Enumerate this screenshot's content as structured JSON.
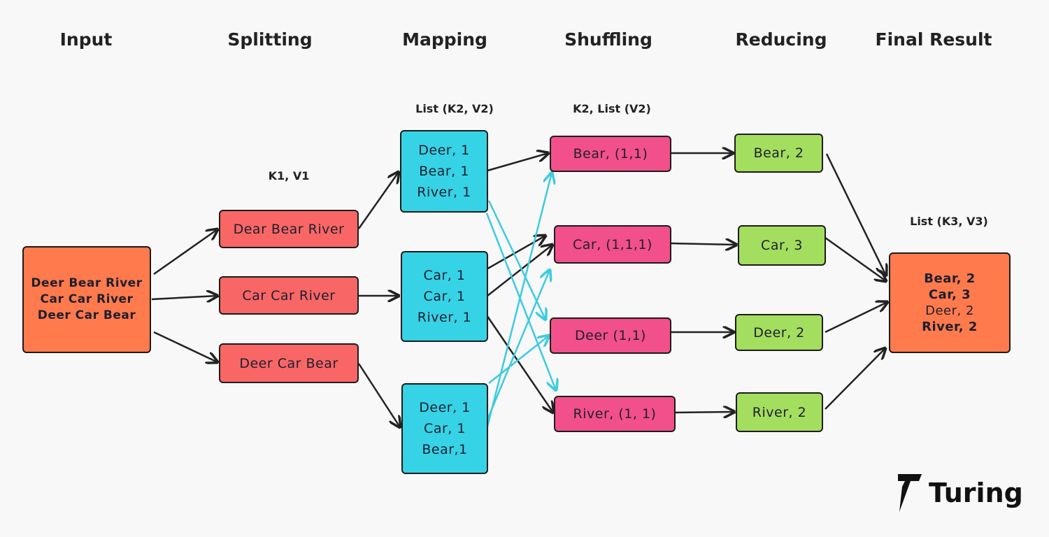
{
  "headers": [
    "Input",
    "Splitting",
    "Mapping",
    "Shuffling",
    "Reducing",
    "Final Result"
  ],
  "labels": {
    "split": "K1, V1",
    "map": "List (K2, V2)",
    "shuffle": "K2, List (V2)",
    "final": "List (K3, V3)"
  },
  "input": [
    "Deer Bear River",
    "Car Car River",
    "Deer Car Bear"
  ],
  "splitting": [
    "Dear Bear River",
    "Car Car River",
    "Deer Car Bear"
  ],
  "mapping": [
    [
      "Deer, 1",
      "Bear, 1",
      "River, 1"
    ],
    [
      "Car, 1",
      "Car, 1",
      "River, 1"
    ],
    [
      "Deer, 1",
      "Car, 1",
      "Bear,1"
    ]
  ],
  "shuffling": [
    "Bear, (1,1)",
    "Car, (1,1,1)",
    "Deer (1,1)",
    "River, (1, 1)"
  ],
  "reducing": [
    "Bear, 2",
    "Car, 3",
    "Deer, 2",
    "River, 2"
  ],
  "final": [
    "Bear, 2",
    "Car, 3",
    "Deer, 2",
    "River, 2"
  ],
  "logo": {
    "text": "Turing",
    "icon": "turing-7-logo-icon"
  },
  "colors": {
    "input": "#FF7A4D",
    "split": "#F86666",
    "map": "#36D3E6",
    "shuffle": "#F2508A",
    "reduce": "#A3DE5E",
    "final": "#FF7A4D",
    "arrow": "#222222",
    "cross_arrow": "#3CCBE0"
  }
}
